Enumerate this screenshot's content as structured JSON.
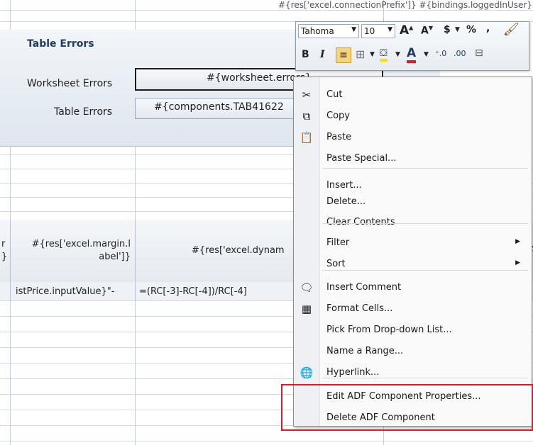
{
  "top_formula": "#{res['excel.connectionPrefix']} #{bindings.loggedInUser}",
  "panel": {
    "title": "Table Errors",
    "rows": [
      {
        "label": "Worksheet Errors",
        "value": "#{worksheet.errors}"
      },
      {
        "label": "Table Errors",
        "value": "#{components.TAB41622"
      }
    ]
  },
  "table": {
    "header_left_fragment": "r\n}",
    "header_margin": "#{res['excel.margin.l\nabel']}",
    "header_dynamic": "#{res['excel.dynam",
    "header_right_fragment": "A",
    "row1_left": "istPrice.inputValue}\"-",
    "row1_formula": "=(RC[-3]-RC[-4])/RC[-4]"
  },
  "toolbar": {
    "font": "Tahoma",
    "size": "10",
    "grow_label": "A",
    "shrink_label": "A",
    "currency": "$",
    "percent": "%",
    "comma": ",",
    "bold": "B",
    "italic": "I",
    "font_color_label": "A"
  },
  "context_menu": {
    "items": [
      {
        "label": "Cut",
        "icon": "scissors-icon",
        "glyph": "✂"
      },
      {
        "label": "Copy",
        "icon": "copy-icon",
        "glyph": "⧉"
      },
      {
        "label": "Paste",
        "icon": "paste-icon",
        "glyph": "📋"
      },
      {
        "label": "Paste Special...",
        "icon": "",
        "glyph": ""
      },
      {
        "label": "Insert...",
        "icon": "",
        "glyph": ""
      },
      {
        "label": "Delete...",
        "icon": "",
        "glyph": ""
      },
      {
        "label": "Clear Contents",
        "icon": "",
        "glyph": ""
      },
      {
        "label": "Filter",
        "icon": "",
        "glyph": "",
        "submenu": true
      },
      {
        "label": "Sort",
        "icon": "",
        "glyph": "",
        "submenu": true
      },
      {
        "label": "Insert Comment",
        "icon": "comment-icon",
        "glyph": "🗨"
      },
      {
        "label": "Format Cells...",
        "icon": "format-cells-icon",
        "glyph": "▦"
      },
      {
        "label": "Pick From Drop-down List...",
        "icon": "",
        "glyph": ""
      },
      {
        "label": "Name a Range...",
        "icon": "",
        "glyph": ""
      },
      {
        "label": "Hyperlink...",
        "icon": "hyperlink-icon",
        "glyph": "🌐"
      },
      {
        "label": "Edit ADF Component Properties...",
        "icon": "",
        "glyph": ""
      },
      {
        "label": "Delete ADF Component",
        "icon": "",
        "glyph": ""
      }
    ]
  },
  "colors": {
    "highlight_box": "#e0182a",
    "panel_title": "#1f3c6b"
  }
}
